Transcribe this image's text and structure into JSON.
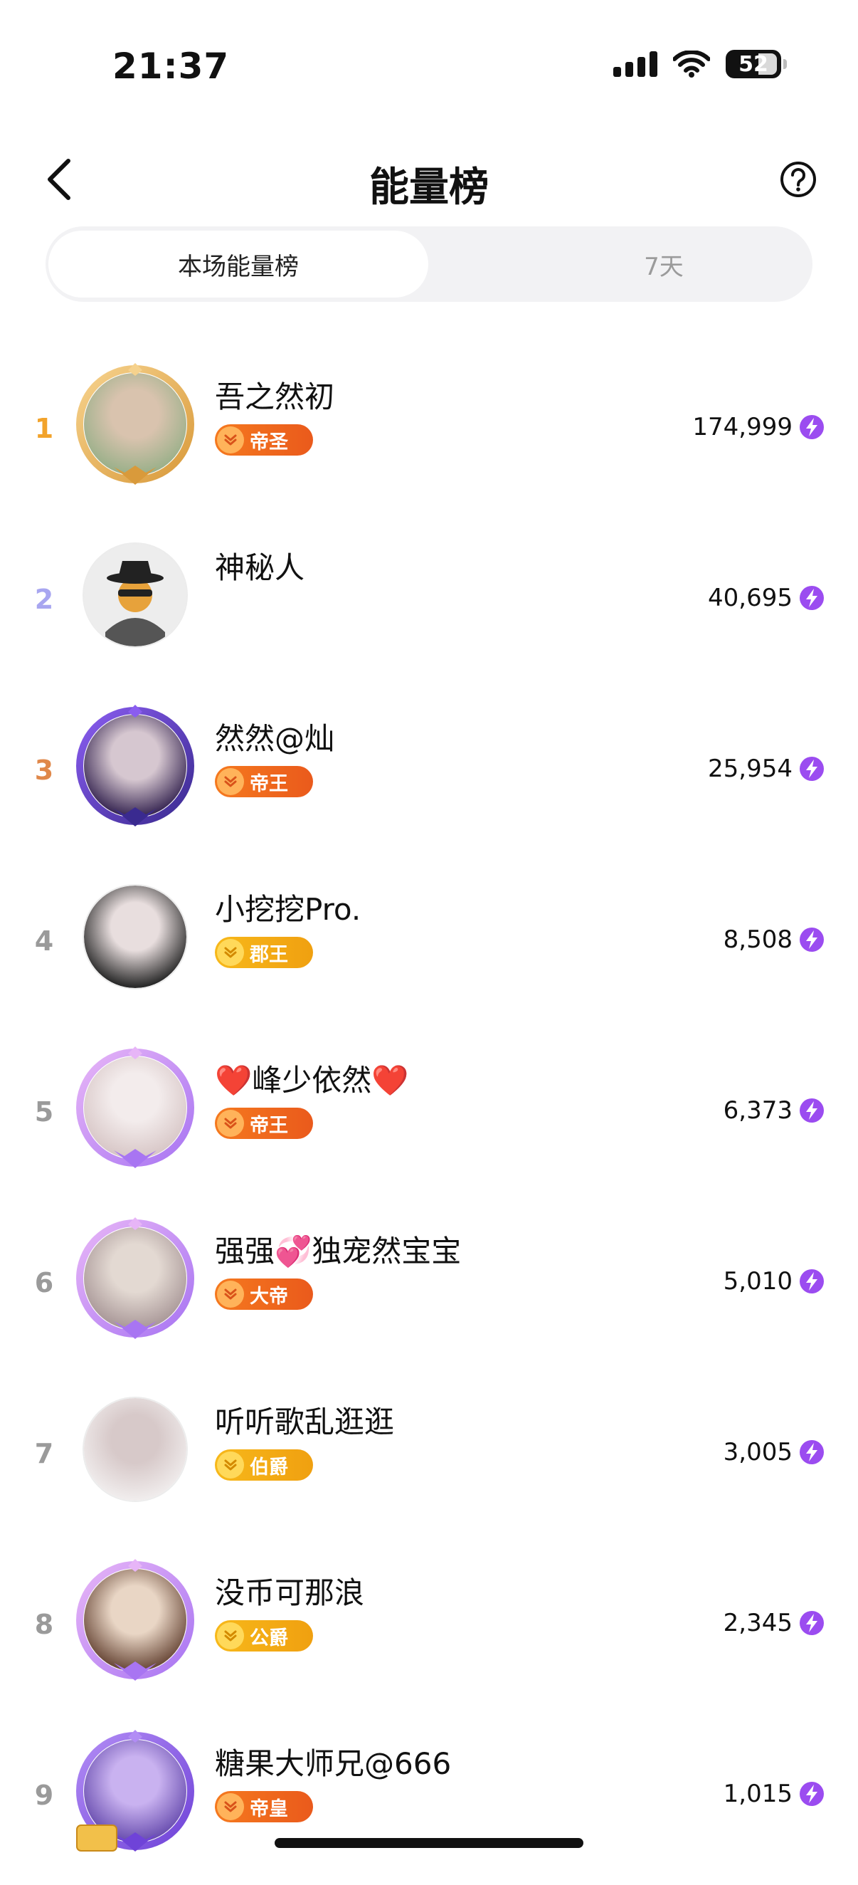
{
  "status_bar": {
    "time": "21:37",
    "battery": "52"
  },
  "header": {
    "title": "能量榜"
  },
  "tabs": [
    {
      "label": "本场能量榜",
      "active": true
    },
    {
      "label": "7天",
      "active": false
    }
  ],
  "icons": {
    "back": "chevron-left-icon",
    "help": "question-circle-icon",
    "energy": "lightning-icon"
  },
  "colors": {
    "rank1": "#f2a32b",
    "rank2": "#a8a6f0",
    "rank3": "#e0884a",
    "rank_other": "#9a9a9a",
    "energy": "#9b4cf0",
    "badge_orange": "#f06a1f",
    "badge_gold": "#f2a516"
  },
  "ranking": [
    {
      "rank": "1",
      "name": "吾之然初",
      "badge": "帝圣",
      "badge_tier": "orange",
      "score": "174,999"
    },
    {
      "rank": "2",
      "name": "神秘人",
      "badge": "",
      "badge_tier": "none",
      "score": "40,695"
    },
    {
      "rank": "3",
      "name": "然然@灿",
      "badge": "帝王",
      "badge_tier": "orange",
      "score": "25,954"
    },
    {
      "rank": "4",
      "name": "小挖挖Pro.",
      "badge": "郡王",
      "badge_tier": "gold",
      "score": "8,508"
    },
    {
      "rank": "5",
      "name": "❤️峰少依然❤️",
      "badge": "帝王",
      "badge_tier": "orange",
      "score": "6,373"
    },
    {
      "rank": "6",
      "name": "强强💞独宠然宝宝",
      "badge": "大帝",
      "badge_tier": "orange",
      "score": "5,010"
    },
    {
      "rank": "7",
      "name": "听听歌乱逛逛",
      "badge": "伯爵",
      "badge_tier": "gold",
      "score": "3,005"
    },
    {
      "rank": "8",
      "name": "没币可那浪",
      "badge": "公爵",
      "badge_tier": "gold",
      "score": "2,345"
    },
    {
      "rank": "9",
      "name": "糖果大师兄@666",
      "badge": "帝皇",
      "badge_tier": "orange",
      "score": "1,015"
    }
  ]
}
